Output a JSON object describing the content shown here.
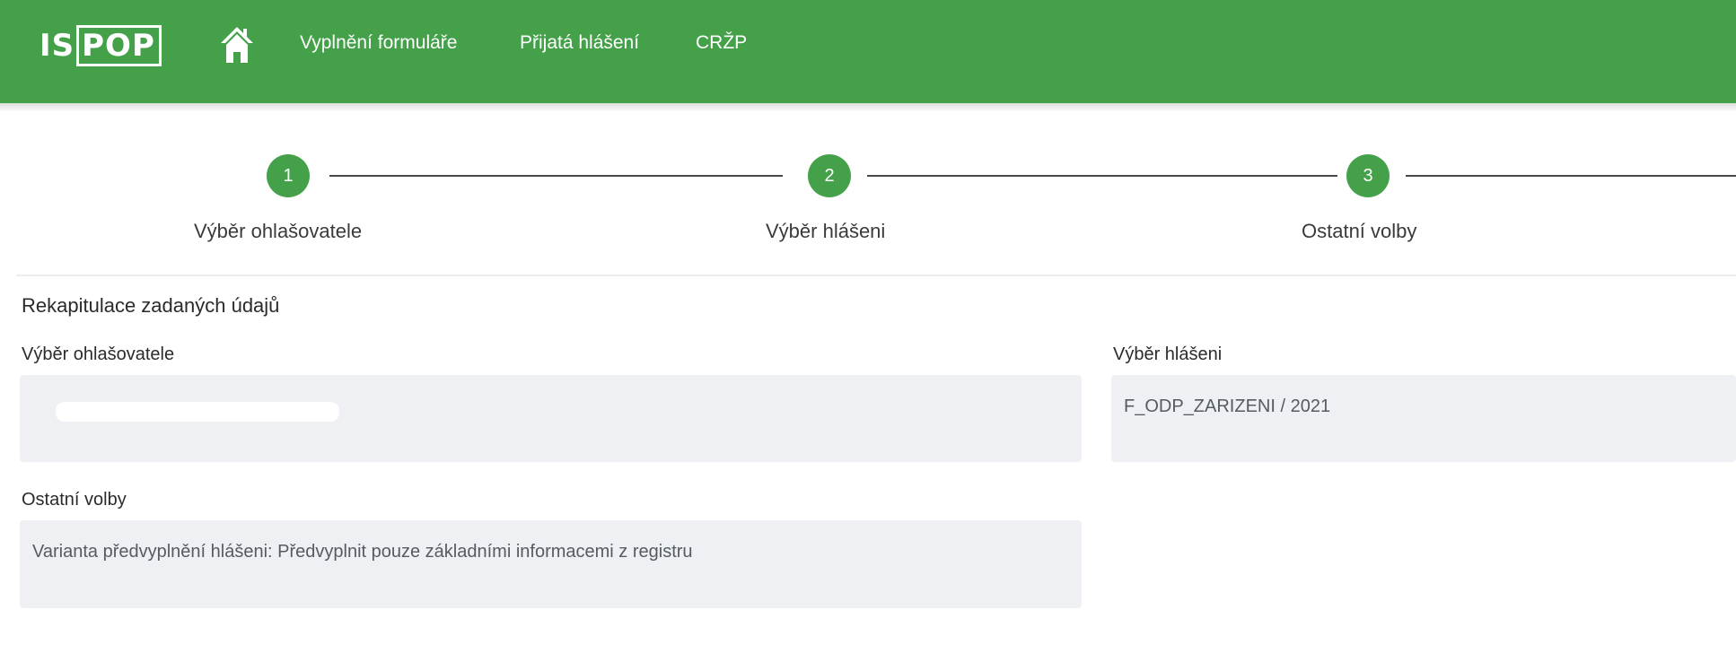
{
  "header": {
    "logo_left": "IS",
    "logo_boxed": "POP",
    "home_icon": "home-icon",
    "nav": [
      {
        "label": "Vyplnění formuláře"
      },
      {
        "label": "Přijatá hlášení"
      },
      {
        "label": "CRŽP"
      }
    ]
  },
  "stepper": {
    "steps": [
      {
        "number": "1",
        "label": "Výběr ohlašovatele"
      },
      {
        "number": "2",
        "label": "Výběr hlášeni"
      },
      {
        "number": "3",
        "label": "Ostatní volby"
      }
    ]
  },
  "summary": {
    "title": "Rekapitulace zadaných údajů",
    "reporter": {
      "label": "Výběr ohlašovatele",
      "value": ""
    },
    "report": {
      "label": "Výběr hlášeni",
      "value": "F_ODP_ZARIZENI / 2021"
    },
    "other": {
      "label": "Ostatní volby",
      "value": "Varianta předvyplnění hlášeni: Předvyplnit pouze základními informacemi z registru"
    }
  },
  "colors": {
    "brand_green": "#44a14a",
    "field_bg": "#eef0f3"
  }
}
